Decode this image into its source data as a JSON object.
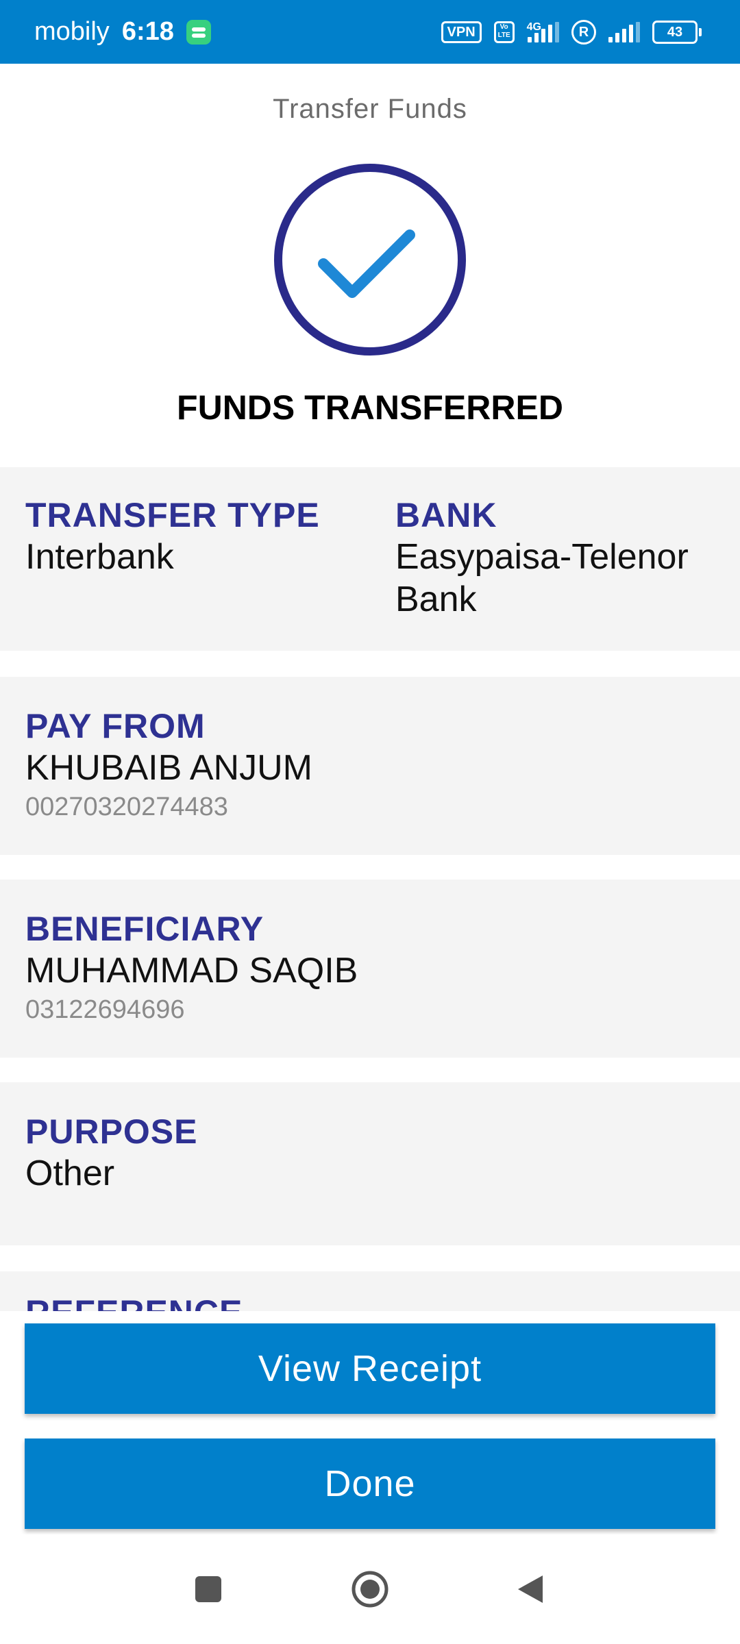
{
  "status_bar": {
    "carrier": "mobily",
    "time": "6:18",
    "vpn": "VPN",
    "volte": "Vo LTE",
    "network": "4G",
    "roaming": "R",
    "battery": "43",
    "background_color": "#0180CB"
  },
  "header": {
    "title": "Transfer Funds"
  },
  "result": {
    "icon": "checkmark-circle-icon",
    "title": "FUNDS TRANSFERRED",
    "circle_color": "#2A2A8A",
    "check_color": "#1E88D6"
  },
  "details": {
    "transfer_type": {
      "label": "TRANSFER TYPE",
      "value": "Interbank"
    },
    "bank": {
      "label": "BANK",
      "value": "Easypaisa-Telenor Bank"
    },
    "pay_from": {
      "label": "PAY FROM",
      "name": "KHUBAIB ANJUM",
      "account": "00270320274483"
    },
    "beneficiary": {
      "label": "BENEFICIARY",
      "name": "MUHAMMAD SAQIB",
      "account": "03122694696"
    },
    "purpose": {
      "label": "PURPOSE",
      "value": "Other"
    },
    "reference": {
      "label": "REFERENCE"
    },
    "label_color": "#2E3192",
    "card_background": "#F4F4F4"
  },
  "actions": {
    "view_receipt": "View Receipt",
    "done": "Done",
    "button_color": "#0180CB"
  },
  "nav": {
    "recent": "recent-apps-icon",
    "home": "home-icon",
    "back": "back-icon"
  }
}
